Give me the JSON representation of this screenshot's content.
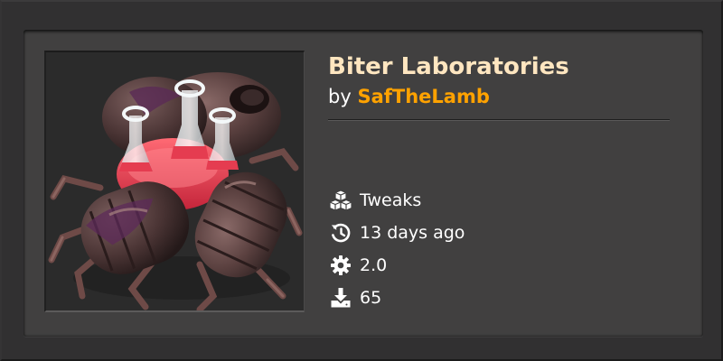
{
  "mod": {
    "title": "Biter Laboratories",
    "by_label": "by",
    "author": "SafTheLamb",
    "thumbnail_alt": "Biter laboratory thumbnail"
  },
  "meta": {
    "category": "Tweaks",
    "category_icon": "cubes-icon",
    "updated": "13 days ago",
    "updated_icon": "history-icon",
    "version": "2.0",
    "version_icon": "gear-icon",
    "downloads": "65",
    "downloads_icon": "download-icon"
  },
  "colors": {
    "title": "#ffe6c0",
    "author": "#ffa200",
    "panel": "#414040",
    "background": "#313031"
  }
}
